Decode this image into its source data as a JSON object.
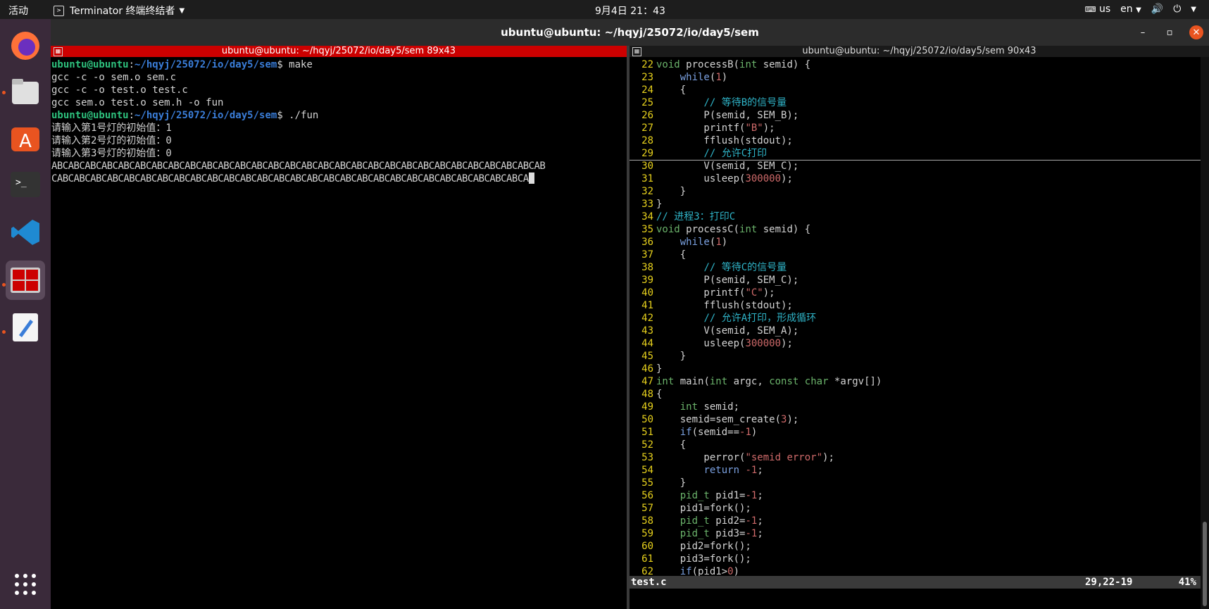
{
  "topbar": {
    "activities": "活动",
    "app_name": "Terminator 终端终结者",
    "clock": "9月4日  21：43",
    "keyboard": "us",
    "lang": "en"
  },
  "window": {
    "title": "ubuntu@ubuntu: ~/hqyj/25072/io/day5/sem"
  },
  "left_pane": {
    "title": "ubuntu@ubuntu: ~/hqyj/25072/io/day5/sem 89x43",
    "prompt_user": "ubuntu@ubuntu",
    "prompt_path": "~/hqyj/25072/io/day5/sem",
    "cmd1": " make",
    "out1": "gcc -c -o sem.o sem.c",
    "out2": "gcc -c -o test.o test.c",
    "out3": "gcc sem.o test.o sem.h -o fun",
    "cmd2": " ./fun",
    "in1": "请输入第1号灯的初始值：1",
    "in2": "请输入第2号灯的初始值：0",
    "in3": "请输入第3号灯的初始值：0",
    "abc1": "ABCABCABCABCABCABCABCABCABCABCABCABCABCABCABCABCABCABCABCABCABCABCABCABCABCABCABCABCABCAB",
    "abc2": "CABCABCABCABCABCABCABCABCABCABCABCABCABCABCABCABCABCABCABCABCABCABCABCABCABCABCABCABCA"
  },
  "right_pane": {
    "title": "ubuntu@ubuntu: ~/hqyj/25072/io/day5/sem 90x43",
    "status_file": "test.c",
    "status_pos": "29,22-19",
    "status_pct": "41%",
    "lines": [
      {
        "n": "22",
        "code": "void processB(int semid) {"
      },
      {
        "n": "23",
        "code": "    while(1)"
      },
      {
        "n": "24",
        "code": "    {"
      },
      {
        "n": "25",
        "code": "        // 等待B的信号量"
      },
      {
        "n": "26",
        "code": "        P(semid, SEM_B);"
      },
      {
        "n": "27",
        "code": "        printf(\"B\");"
      },
      {
        "n": "28",
        "code": "        fflush(stdout);"
      },
      {
        "n": "29",
        "code": "        // 允许C打印"
      },
      {
        "n": "30",
        "code": "        V(semid, SEM_C);"
      },
      {
        "n": "31",
        "code": "        usleep(300000);"
      },
      {
        "n": "32",
        "code": "    }"
      },
      {
        "n": "33",
        "code": "}"
      },
      {
        "n": "34",
        "code": "// 进程3：打印C"
      },
      {
        "n": "35",
        "code": "void processC(int semid) {"
      },
      {
        "n": "36",
        "code": "    while(1)"
      },
      {
        "n": "37",
        "code": "    {"
      },
      {
        "n": "38",
        "code": "        // 等待C的信号量"
      },
      {
        "n": "39",
        "code": "        P(semid, SEM_C);"
      },
      {
        "n": "40",
        "code": "        printf(\"C\");"
      },
      {
        "n": "41",
        "code": "        fflush(stdout);"
      },
      {
        "n": "42",
        "code": "        // 允许A打印，形成循环"
      },
      {
        "n": "43",
        "code": "        V(semid, SEM_A);"
      },
      {
        "n": "44",
        "code": "        usleep(300000);"
      },
      {
        "n": "45",
        "code": "    }"
      },
      {
        "n": "46",
        "code": "}"
      },
      {
        "n": "47",
        "code": "int main(int argc, const char *argv[])"
      },
      {
        "n": "48",
        "code": "{"
      },
      {
        "n": "49",
        "code": "    int semid;"
      },
      {
        "n": "50",
        "code": "    semid=sem_create(3);"
      },
      {
        "n": "51",
        "code": "    if(semid==-1)"
      },
      {
        "n": "52",
        "code": "    {"
      },
      {
        "n": "53",
        "code": "        perror(\"semid error\");"
      },
      {
        "n": "54",
        "code": "        return -1;"
      },
      {
        "n": "55",
        "code": "    }"
      },
      {
        "n": "56",
        "code": "    pid_t pid1=-1;"
      },
      {
        "n": "57",
        "code": "    pid1=fork();"
      },
      {
        "n": "58",
        "code": "    pid_t pid2=-1;"
      },
      {
        "n": "59",
        "code": "    pid_t pid3=-1;"
      },
      {
        "n": "60",
        "code": "    pid2=fork();"
      },
      {
        "n": "61",
        "code": "    pid3=fork();"
      },
      {
        "n": "62",
        "code": "    if(pid1>0)"
      }
    ]
  }
}
